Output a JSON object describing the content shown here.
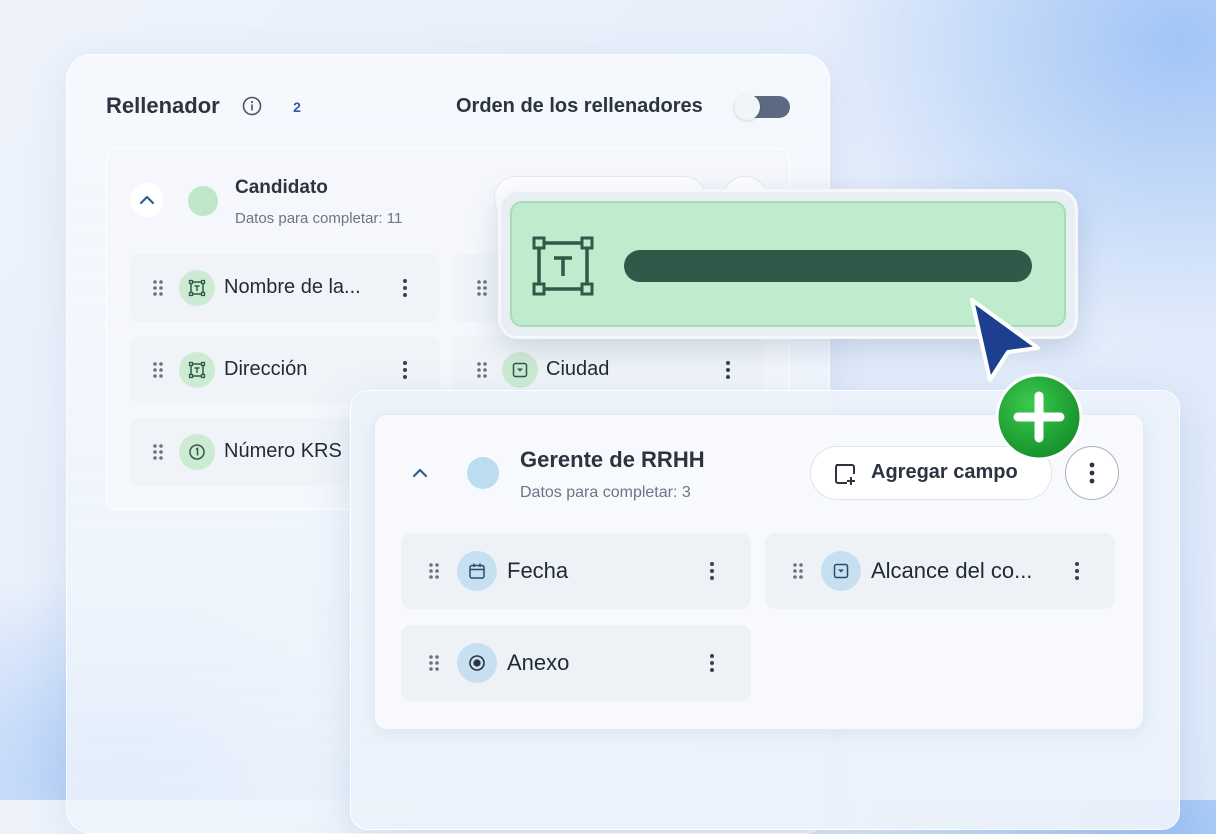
{
  "header": {
    "title": "Rellenador",
    "badge_count": "2",
    "order_label": "Orden de los rellenadores",
    "order_toggle_on": false
  },
  "candidato": {
    "title": "Candidato",
    "subtitle": "Datos para completar: 11",
    "dot_color": "#bfe6c8",
    "fields": [
      {
        "label": "Nombre de la...",
        "icon": "text-field-icon"
      },
      {
        "label": "",
        "icon": ""
      },
      {
        "label": "Dirección",
        "icon": "text-field-icon"
      },
      {
        "label": "Ciudad",
        "icon": "dropdown-icon"
      },
      {
        "label": "Número KRS",
        "icon": "number-icon"
      }
    ]
  },
  "gerente": {
    "title": "Gerente de RRHH",
    "subtitle": "Datos para completar: 3",
    "dot_color": "#bcdcf0",
    "add_field_label": "Agregar campo",
    "fields": [
      {
        "label": "Fecha",
        "icon": "calendar-icon"
      },
      {
        "label": "Alcance del co...",
        "icon": "dropdown-icon"
      },
      {
        "label": "Anexo",
        "icon": "radio-icon"
      }
    ]
  },
  "colors": {
    "green_fill": "#bfeccc",
    "green_icon_bg": "#cdebd3",
    "blue_icon_bg": "#c6dff1",
    "accent_blue": "#2f5f99",
    "cursor": "#1d3f8f",
    "plus_green": "#22a83a"
  }
}
